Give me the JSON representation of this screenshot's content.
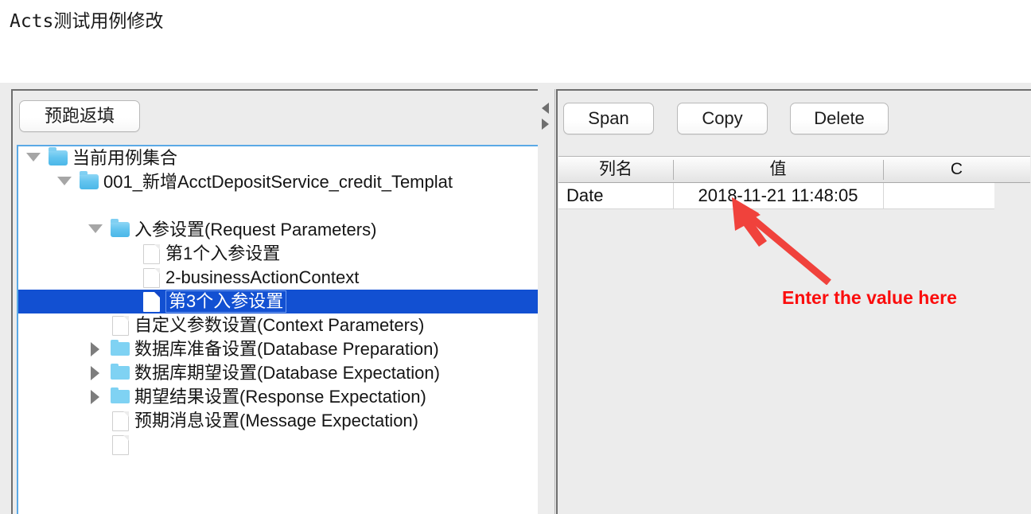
{
  "window": {
    "title": "Acts测试用例修改"
  },
  "left_panel": {
    "toolbar": {
      "prerun_label": "预跑返填"
    },
    "tree": {
      "items": [
        {
          "label": "当前用例集合",
          "icon": "folder-icon",
          "twisty": "expanded",
          "indent": 0
        },
        {
          "label": "001_新增AcctDepositService_credit_Templat",
          "icon": "folder-icon",
          "twisty": "expanded",
          "indent": 1
        },
        {
          "label": "",
          "icon": "none",
          "twisty": "none",
          "indent": 1
        },
        {
          "label": "入参设置(Request Parameters)",
          "icon": "folder-icon",
          "twisty": "expanded",
          "indent": 2
        },
        {
          "label": "第1个入参设置",
          "icon": "file-icon",
          "twisty": "none",
          "indent": 3
        },
        {
          "label": "2-businessActionContext",
          "icon": "file-icon",
          "twisty": "none",
          "indent": 3
        },
        {
          "label": "第3个入参设置",
          "icon": "file-icon",
          "twisty": "none",
          "indent": 3,
          "selected": true
        },
        {
          "label": "自定义参数设置(Context Parameters)",
          "icon": "file-icon",
          "twisty": "none",
          "indent": 2
        },
        {
          "label": "数据库准备设置(Database Preparation)",
          "icon": "folder-flat-icon",
          "twisty": "collapsed",
          "indent": 2
        },
        {
          "label": "数据库期望设置(Database Expectation)",
          "icon": "folder-flat-icon",
          "twisty": "collapsed",
          "indent": 2
        },
        {
          "label": "期望结果设置(Response Expectation)",
          "icon": "folder-flat-icon",
          "twisty": "collapsed",
          "indent": 2
        },
        {
          "label": "预期消息设置(Message Expectation)",
          "icon": "file-icon",
          "twisty": "none",
          "indent": 2
        },
        {
          "label": "",
          "icon": "file-icon",
          "twisty": "none",
          "indent": 2
        }
      ]
    }
  },
  "divider": {
    "collapse_left_icon": "triangle-left-icon",
    "collapse_right_icon": "triangle-right-icon"
  },
  "right_panel": {
    "toolbar": {
      "span_label": "Span",
      "copy_label": "Copy",
      "delete_label": "Delete"
    },
    "table": {
      "columns": [
        "列名",
        "值",
        "C"
      ],
      "rows": [
        {
          "name": "Date",
          "value": "2018-11-21 11:48:05",
          "c": ""
        }
      ]
    }
  },
  "annotation": {
    "text": "Enter the value here",
    "color": "#fb0d0d",
    "arrow_icon": "red-arrow-icon"
  },
  "colors": {
    "selection_blue": "#1250d2",
    "focus_border": "#5aa9e6",
    "folder_blue": "#63c4ef",
    "window_background": "#ececec",
    "annotation_red": "#fb0d0d"
  }
}
